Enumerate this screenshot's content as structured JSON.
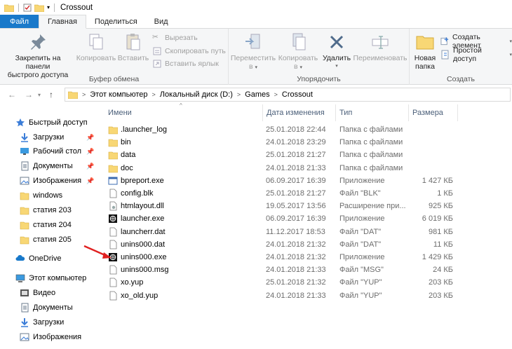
{
  "window": {
    "title": "Crossout"
  },
  "tabs": [
    {
      "label": "Файл"
    },
    {
      "label": "Главная"
    },
    {
      "label": "Поделиться"
    },
    {
      "label": "Вид"
    }
  ],
  "ribbon": {
    "clipboard": {
      "pin_label_line1": "Закрепить на панели",
      "pin_label_line2": "быстрого доступа",
      "copy_label": "Копировать",
      "paste_label": "Вставить",
      "cut_label": "Вырезать",
      "copy_path_label": "Скопировать путь",
      "paste_shortcut_label": "Вставить ярлык",
      "group_label": "Буфер обмена"
    },
    "organize": {
      "move_label_line1": "Переместить",
      "move_label_line2": "в",
      "copyto_label_line1": "Копировать",
      "copyto_label_line2": "в",
      "delete_label": "Удалить",
      "rename_label": "Переименовать",
      "group_label": "Упорядочить"
    },
    "create": {
      "new_folder_line1": "Новая",
      "new_folder_line2": "папка",
      "new_item_label": "Создать элемент",
      "easy_access_label": "Простой доступ",
      "group_label": "Создать"
    }
  },
  "address": {
    "crumbs": [
      "Этот компьютер",
      "Локальный диск (D:)",
      "Games",
      "Crossout"
    ]
  },
  "nav": {
    "quick_access": "Быстрый доступ",
    "items": [
      {
        "label": "Загрузки",
        "icon": "download-icon",
        "pinned": true
      },
      {
        "label": "Рабочий стол",
        "icon": "desktop-icon",
        "pinned": true
      },
      {
        "label": "Документы",
        "icon": "documents-icon",
        "pinned": true
      },
      {
        "label": "Изображения",
        "icon": "pictures-icon",
        "pinned": true
      },
      {
        "label": "windows",
        "icon": "folder-icon",
        "pinned": false
      },
      {
        "label": "статия 203",
        "icon": "folder-icon",
        "pinned": false
      },
      {
        "label": "статия 204",
        "icon": "folder-icon",
        "pinned": false
      },
      {
        "label": "статия 205",
        "icon": "folder-icon",
        "pinned": false
      }
    ],
    "onedrive": "OneDrive",
    "this_pc": "Этот компьютер",
    "pc_items": [
      {
        "label": "Видео",
        "icon": "video-icon"
      },
      {
        "label": "Документы",
        "icon": "documents-icon"
      },
      {
        "label": "Загрузки",
        "icon": "download-icon"
      },
      {
        "label": "Изображения",
        "icon": "pictures-icon"
      }
    ]
  },
  "columns": {
    "name": "Имени",
    "date": "Дата изменения",
    "type": "Тип",
    "size": "Размера"
  },
  "files": [
    {
      "name": ".launcher_log",
      "date": "25.01.2018 22:44",
      "type": "Папка с файлами",
      "size": "",
      "icon": "folder-icon"
    },
    {
      "name": "bin",
      "date": "24.01.2018 23:29",
      "type": "Папка с файлами",
      "size": "",
      "icon": "folder-icon"
    },
    {
      "name": "data",
      "date": "25.01.2018 21:27",
      "type": "Папка с файлами",
      "size": "",
      "icon": "folder-icon"
    },
    {
      "name": "doc",
      "date": "24.01.2018 21:33",
      "type": "Папка с файлами",
      "size": "",
      "icon": "folder-icon"
    },
    {
      "name": "bpreport.exe",
      "date": "06.09.2017 16:39",
      "type": "Приложение",
      "size": "1 427 КБ",
      "icon": "exe-icon"
    },
    {
      "name": "config.blk",
      "date": "25.01.2018 21:27",
      "type": "Файл \"BLK\"",
      "size": "1 КБ",
      "icon": "file-icon"
    },
    {
      "name": "htmlayout.dll",
      "date": "19.05.2017 13:56",
      "type": "Расширение при...",
      "size": "925 КБ",
      "icon": "dll-icon"
    },
    {
      "name": "launcher.exe",
      "date": "06.09.2017 16:39",
      "type": "Приложение",
      "size": "6 019 КБ",
      "icon": "app-icon"
    },
    {
      "name": "launcherr.dat",
      "date": "11.12.2017 18:53",
      "type": "Файл \"DAT\"",
      "size": "981 КБ",
      "icon": "file-icon"
    },
    {
      "name": "unins000.dat",
      "date": "24.01.2018 21:32",
      "type": "Файл \"DAT\"",
      "size": "11 КБ",
      "icon": "file-icon"
    },
    {
      "name": "unins000.exe",
      "date": "24.01.2018 21:32",
      "type": "Приложение",
      "size": "1 429 КБ",
      "icon": "app-icon"
    },
    {
      "name": "unins000.msg",
      "date": "24.01.2018 21:33",
      "type": "Файл \"MSG\"",
      "size": "24 КБ",
      "icon": "file-icon"
    },
    {
      "name": "xo.yup",
      "date": "25.01.2018 21:32",
      "type": "Файл \"YUP\"",
      "size": "203 КБ",
      "icon": "file-icon"
    },
    {
      "name": "xo_old.yup",
      "date": "24.01.2018 21:33",
      "type": "Файл \"YUP\"",
      "size": "203 КБ",
      "icon": "file-icon"
    }
  ],
  "colors": {
    "accent": "#1979ca",
    "folder": "#f8d775",
    "header_text": "#4c607a",
    "annotation_arrow": "#e02020"
  }
}
